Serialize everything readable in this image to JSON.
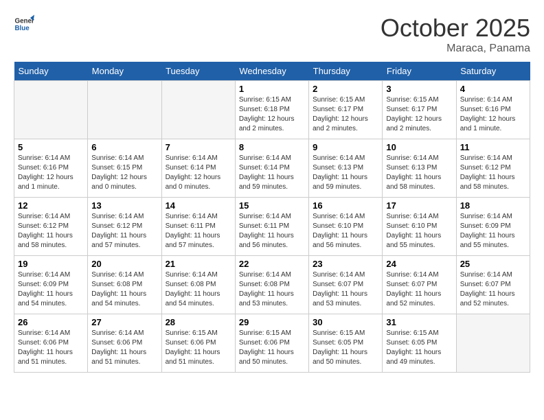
{
  "header": {
    "logo_line1": "General",
    "logo_line2": "Blue",
    "month": "October 2025",
    "location": "Maraca, Panama"
  },
  "days_of_week": [
    "Sunday",
    "Monday",
    "Tuesday",
    "Wednesday",
    "Thursday",
    "Friday",
    "Saturday"
  ],
  "weeks": [
    [
      {
        "num": "",
        "sunrise": "",
        "sunset": "",
        "daylight": "",
        "empty": true
      },
      {
        "num": "",
        "sunrise": "",
        "sunset": "",
        "daylight": "",
        "empty": true
      },
      {
        "num": "",
        "sunrise": "",
        "sunset": "",
        "daylight": "",
        "empty": true
      },
      {
        "num": "1",
        "sunrise": "Sunrise: 6:15 AM",
        "sunset": "Sunset: 6:18 PM",
        "daylight": "Daylight: 12 hours and 2 minutes.",
        "empty": false
      },
      {
        "num": "2",
        "sunrise": "Sunrise: 6:15 AM",
        "sunset": "Sunset: 6:17 PM",
        "daylight": "Daylight: 12 hours and 2 minutes.",
        "empty": false
      },
      {
        "num": "3",
        "sunrise": "Sunrise: 6:15 AM",
        "sunset": "Sunset: 6:17 PM",
        "daylight": "Daylight: 12 hours and 2 minutes.",
        "empty": false
      },
      {
        "num": "4",
        "sunrise": "Sunrise: 6:14 AM",
        "sunset": "Sunset: 6:16 PM",
        "daylight": "Daylight: 12 hours and 1 minute.",
        "empty": false
      }
    ],
    [
      {
        "num": "5",
        "sunrise": "Sunrise: 6:14 AM",
        "sunset": "Sunset: 6:16 PM",
        "daylight": "Daylight: 12 hours and 1 minute.",
        "empty": false
      },
      {
        "num": "6",
        "sunrise": "Sunrise: 6:14 AM",
        "sunset": "Sunset: 6:15 PM",
        "daylight": "Daylight: 12 hours and 0 minutes.",
        "empty": false
      },
      {
        "num": "7",
        "sunrise": "Sunrise: 6:14 AM",
        "sunset": "Sunset: 6:14 PM",
        "daylight": "Daylight: 12 hours and 0 minutes.",
        "empty": false
      },
      {
        "num": "8",
        "sunrise": "Sunrise: 6:14 AM",
        "sunset": "Sunset: 6:14 PM",
        "daylight": "Daylight: 11 hours and 59 minutes.",
        "empty": false
      },
      {
        "num": "9",
        "sunrise": "Sunrise: 6:14 AM",
        "sunset": "Sunset: 6:13 PM",
        "daylight": "Daylight: 11 hours and 59 minutes.",
        "empty": false
      },
      {
        "num": "10",
        "sunrise": "Sunrise: 6:14 AM",
        "sunset": "Sunset: 6:13 PM",
        "daylight": "Daylight: 11 hours and 58 minutes.",
        "empty": false
      },
      {
        "num": "11",
        "sunrise": "Sunrise: 6:14 AM",
        "sunset": "Sunset: 6:12 PM",
        "daylight": "Daylight: 11 hours and 58 minutes.",
        "empty": false
      }
    ],
    [
      {
        "num": "12",
        "sunrise": "Sunrise: 6:14 AM",
        "sunset": "Sunset: 6:12 PM",
        "daylight": "Daylight: 11 hours and 58 minutes.",
        "empty": false
      },
      {
        "num": "13",
        "sunrise": "Sunrise: 6:14 AM",
        "sunset": "Sunset: 6:12 PM",
        "daylight": "Daylight: 11 hours and 57 minutes.",
        "empty": false
      },
      {
        "num": "14",
        "sunrise": "Sunrise: 6:14 AM",
        "sunset": "Sunset: 6:11 PM",
        "daylight": "Daylight: 11 hours and 57 minutes.",
        "empty": false
      },
      {
        "num": "15",
        "sunrise": "Sunrise: 6:14 AM",
        "sunset": "Sunset: 6:11 PM",
        "daylight": "Daylight: 11 hours and 56 minutes.",
        "empty": false
      },
      {
        "num": "16",
        "sunrise": "Sunrise: 6:14 AM",
        "sunset": "Sunset: 6:10 PM",
        "daylight": "Daylight: 11 hours and 56 minutes.",
        "empty": false
      },
      {
        "num": "17",
        "sunrise": "Sunrise: 6:14 AM",
        "sunset": "Sunset: 6:10 PM",
        "daylight": "Daylight: 11 hours and 55 minutes.",
        "empty": false
      },
      {
        "num": "18",
        "sunrise": "Sunrise: 6:14 AM",
        "sunset": "Sunset: 6:09 PM",
        "daylight": "Daylight: 11 hours and 55 minutes.",
        "empty": false
      }
    ],
    [
      {
        "num": "19",
        "sunrise": "Sunrise: 6:14 AM",
        "sunset": "Sunset: 6:09 PM",
        "daylight": "Daylight: 11 hours and 54 minutes.",
        "empty": false
      },
      {
        "num": "20",
        "sunrise": "Sunrise: 6:14 AM",
        "sunset": "Sunset: 6:08 PM",
        "daylight": "Daylight: 11 hours and 54 minutes.",
        "empty": false
      },
      {
        "num": "21",
        "sunrise": "Sunrise: 6:14 AM",
        "sunset": "Sunset: 6:08 PM",
        "daylight": "Daylight: 11 hours and 54 minutes.",
        "empty": false
      },
      {
        "num": "22",
        "sunrise": "Sunrise: 6:14 AM",
        "sunset": "Sunset: 6:08 PM",
        "daylight": "Daylight: 11 hours and 53 minutes.",
        "empty": false
      },
      {
        "num": "23",
        "sunrise": "Sunrise: 6:14 AM",
        "sunset": "Sunset: 6:07 PM",
        "daylight": "Daylight: 11 hours and 53 minutes.",
        "empty": false
      },
      {
        "num": "24",
        "sunrise": "Sunrise: 6:14 AM",
        "sunset": "Sunset: 6:07 PM",
        "daylight": "Daylight: 11 hours and 52 minutes.",
        "empty": false
      },
      {
        "num": "25",
        "sunrise": "Sunrise: 6:14 AM",
        "sunset": "Sunset: 6:07 PM",
        "daylight": "Daylight: 11 hours and 52 minutes.",
        "empty": false
      }
    ],
    [
      {
        "num": "26",
        "sunrise": "Sunrise: 6:14 AM",
        "sunset": "Sunset: 6:06 PM",
        "daylight": "Daylight: 11 hours and 51 minutes.",
        "empty": false
      },
      {
        "num": "27",
        "sunrise": "Sunrise: 6:14 AM",
        "sunset": "Sunset: 6:06 PM",
        "daylight": "Daylight: 11 hours and 51 minutes.",
        "empty": false
      },
      {
        "num": "28",
        "sunrise": "Sunrise: 6:15 AM",
        "sunset": "Sunset: 6:06 PM",
        "daylight": "Daylight: 11 hours and 51 minutes.",
        "empty": false
      },
      {
        "num": "29",
        "sunrise": "Sunrise: 6:15 AM",
        "sunset": "Sunset: 6:06 PM",
        "daylight": "Daylight: 11 hours and 50 minutes.",
        "empty": false
      },
      {
        "num": "30",
        "sunrise": "Sunrise: 6:15 AM",
        "sunset": "Sunset: 6:05 PM",
        "daylight": "Daylight: 11 hours and 50 minutes.",
        "empty": false
      },
      {
        "num": "31",
        "sunrise": "Sunrise: 6:15 AM",
        "sunset": "Sunset: 6:05 PM",
        "daylight": "Daylight: 11 hours and 49 minutes.",
        "empty": false
      },
      {
        "num": "",
        "sunrise": "",
        "sunset": "",
        "daylight": "",
        "empty": true
      }
    ]
  ]
}
